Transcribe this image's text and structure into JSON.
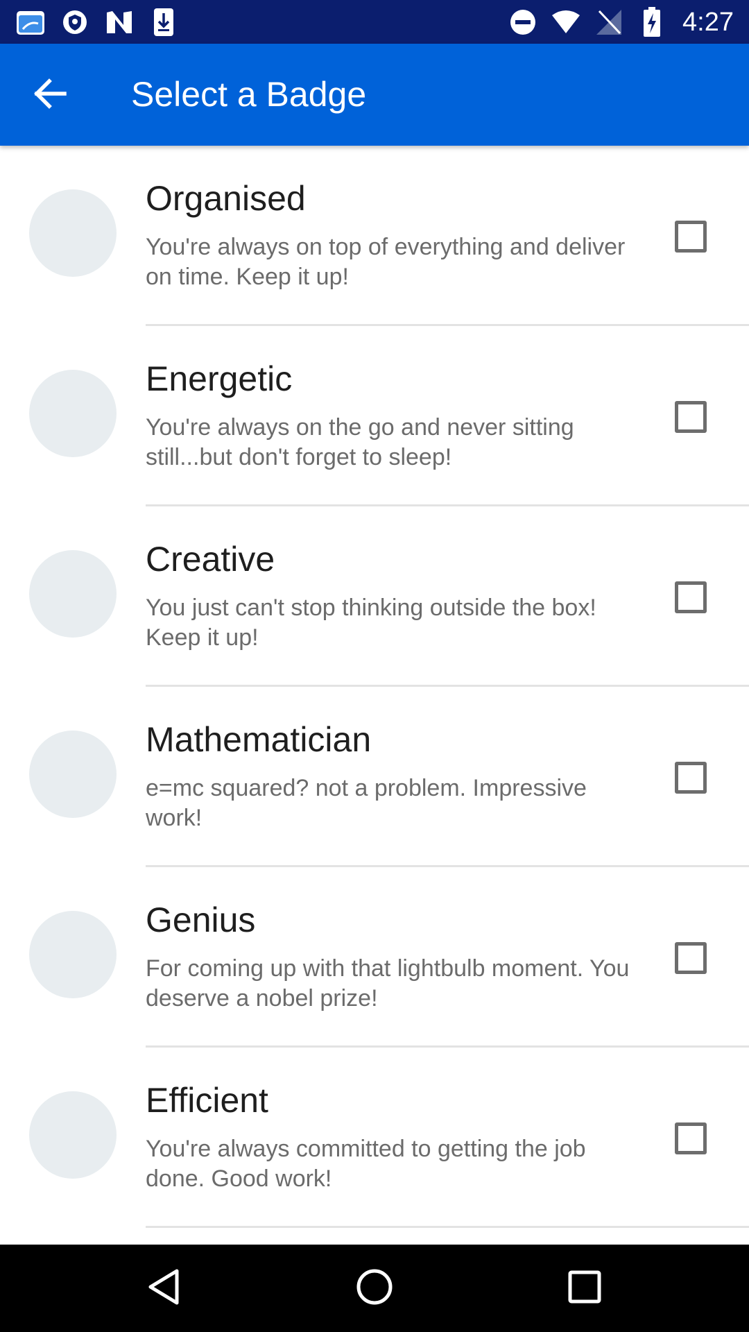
{
  "status_bar": {
    "time": "4:27",
    "left_icons": [
      "file-manager-icon",
      "shield-icon",
      "n-icon",
      "download-icon"
    ],
    "right_icons": [
      "do-not-disturb-icon",
      "wifi-icon",
      "no-signal-icon",
      "battery-charging-icon"
    ]
  },
  "app_bar": {
    "title": "Select a Badge",
    "back_icon": "arrow-left-icon"
  },
  "badges": [
    {
      "title": "Organised",
      "description": "You're always on top of everything and deliver on time. Keep it up!",
      "checked": false
    },
    {
      "title": "Energetic",
      "description": "You're always on the go and never sitting still...but don't forget to sleep!",
      "checked": false
    },
    {
      "title": "Creative",
      "description": "You just can't stop thinking outside the box! Keep it up!",
      "checked": false
    },
    {
      "title": "Mathematician",
      "description": "e=mc squared? not a problem. Impressive work!",
      "checked": false
    },
    {
      "title": "Genius",
      "description": "For coming up with that lightbulb moment. You deserve a nobel prize!",
      "checked": false
    },
    {
      "title": "Efficient",
      "description": "You're always committed to getting the job done. Good work!",
      "checked": false
    }
  ],
  "nav_bar": {
    "icons": [
      "back-triangle-icon",
      "home-circle-icon",
      "recents-square-icon"
    ]
  },
  "colors": {
    "status_bar": "#0b1e6e",
    "app_bar": "#0062d9",
    "avatar": "#e8edf0",
    "checkbox_border": "#6d6d6d"
  }
}
